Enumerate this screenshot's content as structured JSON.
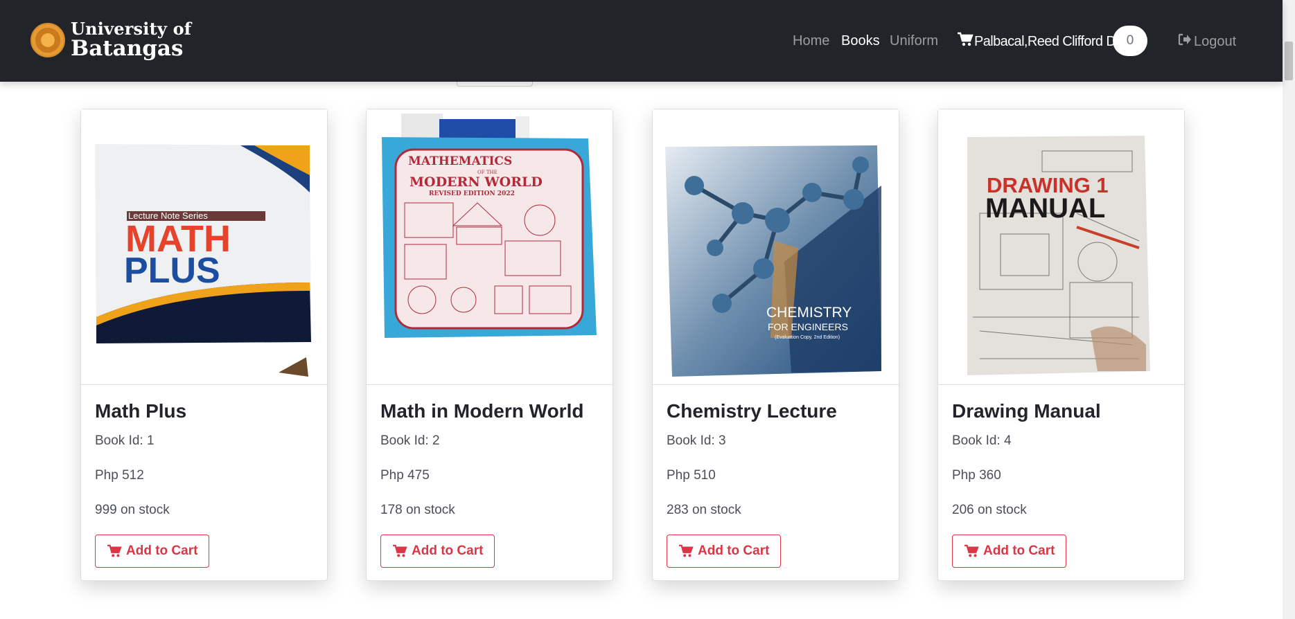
{
  "brand": {
    "line1": "University of",
    "line2": "Batangas"
  },
  "nav": {
    "home": "Home",
    "books": "Books",
    "uniform": "Uniform",
    "user": "Palbacal,Reed Clifford D.",
    "cart_count": "0",
    "logout": "Logout"
  },
  "books": [
    {
      "title": "Math Plus",
      "id_text": "Book Id: 1",
      "price": "Php 512",
      "stock": "999 on stock",
      "button": "Add to Cart",
      "cover": {
        "series": "Lecture Note Series",
        "main": "MATH",
        "sub": "PLUS"
      }
    },
    {
      "title": "Math in Modern World",
      "id_text": "Book Id: 2",
      "price": "Php 475",
      "stock": "178 on stock",
      "button": "Add to Cart",
      "cover": {
        "line1": "MATHEMATICS",
        "line2": "OF THE",
        "line3": "MODERN WORLD",
        "line4": "REVISED EDITION 2022"
      }
    },
    {
      "title": "Chemistry Lecture",
      "id_text": "Book Id: 3",
      "price": "Php 510",
      "stock": "283 on stock",
      "button": "Add to Cart",
      "cover": {
        "main": "CHEMISTRY",
        "sub": "FOR ENGINEERS",
        "note": "(Evaluation Copy, 2nd Edition)"
      }
    },
    {
      "title": "Drawing Manual",
      "id_text": "Book Id: 4",
      "price": "Php 360",
      "stock": "206 on stock",
      "button": "Add to Cart",
      "cover": {
        "line1": "DRAWING 1",
        "line2": "MANUAL"
      }
    }
  ],
  "colors": {
    "navbar": "#212529",
    "accent_red": "#dc3545",
    "text_muted": "#495057"
  }
}
